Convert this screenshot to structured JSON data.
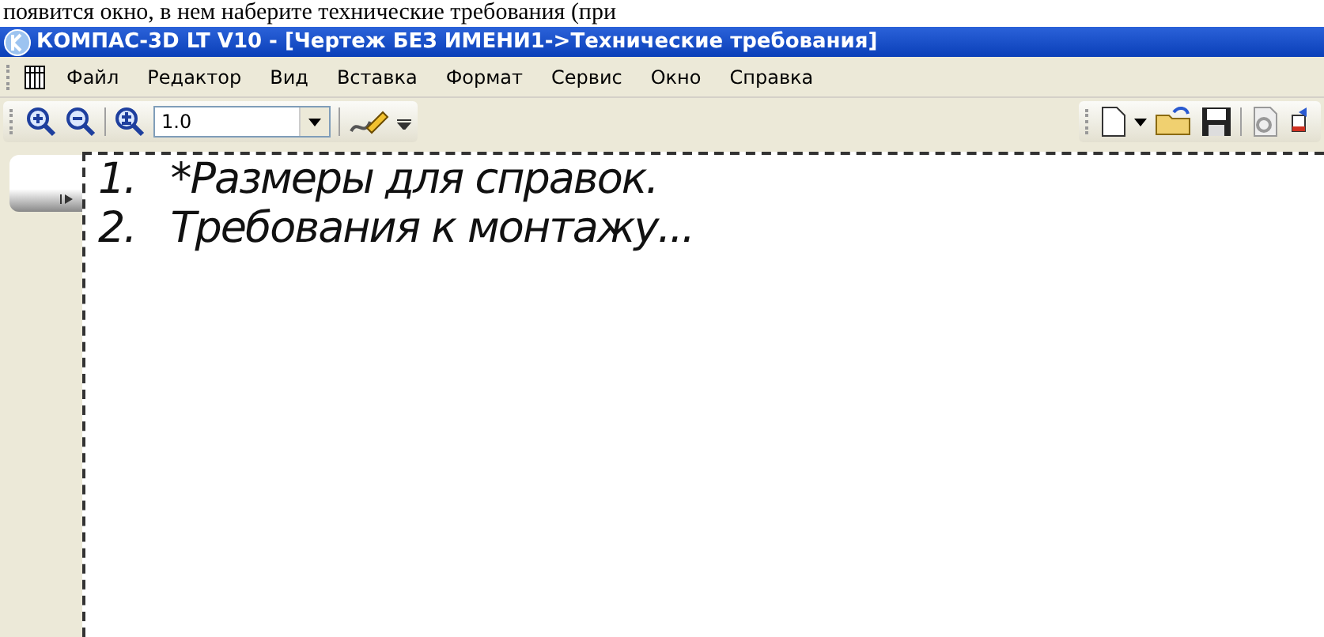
{
  "page_text": "появится окно, в нем наберите технические требования (при",
  "window": {
    "title": "КОМПАС-3D LT V10 - [Чертеж БЕЗ ИМЕНИ1->Технические требования]"
  },
  "menu": [
    "Файл",
    "Редактор",
    "Вид",
    "Вставка",
    "Формат",
    "Сервис",
    "Окно",
    "Справка"
  ],
  "toolbar": {
    "scale": "1.0"
  },
  "document": {
    "lines": [
      {
        "number": "1.",
        "text": "*Размеры для справок."
      },
      {
        "number": "2.",
        "text": "Требования к монтажу..."
      }
    ]
  }
}
